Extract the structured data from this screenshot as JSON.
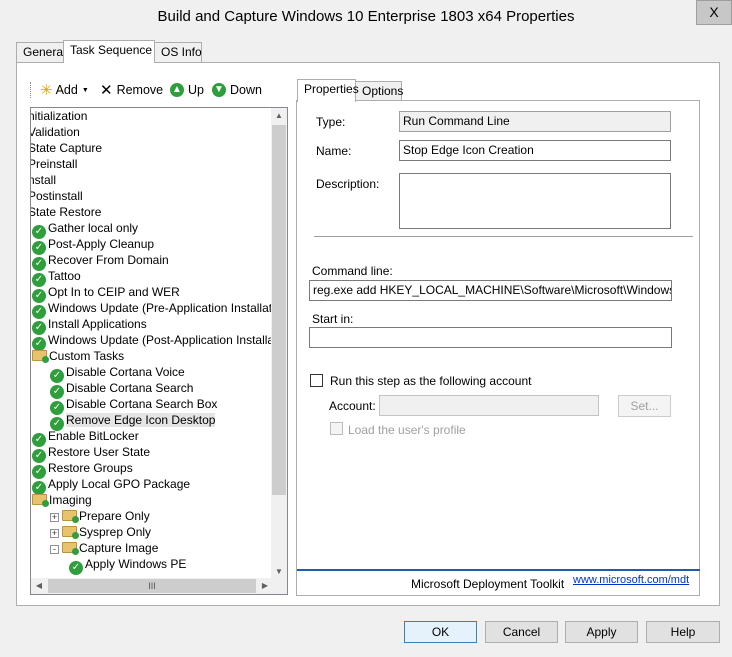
{
  "window": {
    "title": "Build and Capture Windows 10 Enterprise 1803 x64 Properties",
    "close_label": "X"
  },
  "tabs": [
    "General",
    "Task Sequence",
    "OS Info"
  ],
  "toolbar": {
    "add_label": "Add",
    "remove_label": "Remove",
    "up_label": "Up",
    "down_label": "Down"
  },
  "tree": {
    "rows": [
      {
        "label": "nitialization",
        "icon": "none",
        "indent": 0
      },
      {
        "label": "Validation",
        "icon": "none",
        "indent": 0
      },
      {
        "label": "State Capture",
        "icon": "none",
        "indent": 0
      },
      {
        "label": "Preinstall",
        "icon": "none",
        "indent": 0
      },
      {
        "label": "nstall",
        "icon": "none",
        "indent": 0
      },
      {
        "label": "Postinstall",
        "icon": "none",
        "indent": 0
      },
      {
        "label": "State Restore",
        "icon": "none",
        "indent": 0
      },
      {
        "label": "Gather local only",
        "icon": "check",
        "indent": 1
      },
      {
        "label": "Post-Apply Cleanup",
        "icon": "check",
        "indent": 1
      },
      {
        "label": "Recover From Domain",
        "icon": "check",
        "indent": 1
      },
      {
        "label": "Tattoo",
        "icon": "check",
        "indent": 1
      },
      {
        "label": "Opt In to CEIP and WER",
        "icon": "check",
        "indent": 1
      },
      {
        "label": "Windows Update (Pre-Application Installation)",
        "icon": "check",
        "indent": 1
      },
      {
        "label": "Install Applications",
        "icon": "check",
        "indent": 1
      },
      {
        "label": "Windows Update (Post-Application Installation)",
        "icon": "check",
        "indent": 1
      },
      {
        "label": "Custom Tasks",
        "icon": "folder",
        "indent": 1
      },
      {
        "label": "Disable Cortana Voice",
        "icon": "check",
        "indent": 2
      },
      {
        "label": "Disable Cortana Search",
        "icon": "check",
        "indent": 2
      },
      {
        "label": "Disable Cortana Search Box",
        "icon": "check",
        "indent": 2
      },
      {
        "label": "Remove Edge Icon Desktop",
        "icon": "check",
        "indent": 2,
        "selected": true
      },
      {
        "label": "Enable BitLocker",
        "icon": "check",
        "indent": 1
      },
      {
        "label": "Restore User State",
        "icon": "check",
        "indent": 1
      },
      {
        "label": "Restore Groups",
        "icon": "check",
        "indent": 1
      },
      {
        "label": "Apply Local GPO Package",
        "icon": "check",
        "indent": 1
      },
      {
        "label": "Imaging",
        "icon": "folder",
        "indent": 1
      },
      {
        "label": "Prepare Only",
        "icon": "folder",
        "indent": 2,
        "expander": "+"
      },
      {
        "label": "Sysprep Only",
        "icon": "folder",
        "indent": 2,
        "expander": "+"
      },
      {
        "label": "Capture Image",
        "icon": "folder",
        "indent": 2,
        "expander": "-"
      },
      {
        "label": "Apply Windows PE",
        "icon": "check",
        "indent": 3
      }
    ],
    "hscroll_label": "III"
  },
  "right_tabs": [
    "Properties",
    "Options"
  ],
  "properties": {
    "type_label": "Type:",
    "type_value": "Run Command Line",
    "name_label": "Name:",
    "name_value": "Stop Edge Icon Creation",
    "description_label": "Description:",
    "description_value": "",
    "command_line_label": "Command line:",
    "command_line_value": "reg.exe add HKEY_LOCAL_MACHINE\\Software\\Microsoft\\Windows\\CurrentVersion",
    "start_in_label": "Start in:",
    "start_in_value": "",
    "run_as_label": "Run this step as the following account",
    "account_label": "Account:",
    "account_value": "",
    "set_button": "Set...",
    "load_profile_label": "Load the user's profile",
    "mdt_label": "Microsoft Deployment Toolkit",
    "mdt_link": "www.microsoft.com/mdt"
  },
  "buttons": {
    "ok": "OK",
    "cancel": "Cancel",
    "apply": "Apply",
    "help": "Help"
  },
  "colors": {
    "check_green": "#2f9e3c",
    "link_blue": "#0033cc",
    "default_border": "#3c7fb1",
    "mdt_rule": "#1f5da8"
  }
}
